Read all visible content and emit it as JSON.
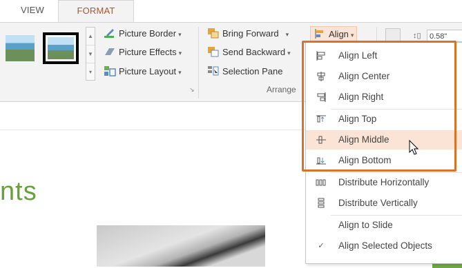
{
  "tabs": {
    "view": "VIEW",
    "format": "FORMAT"
  },
  "ribbon": {
    "picture_styles": {
      "picture_border": "Picture Border",
      "picture_effects": "Picture Effects",
      "picture_layout": "Picture Layout"
    },
    "arrange": {
      "bring_forward": "Bring Forward",
      "send_backward": "Send Backward",
      "selection_pane": "Selection Pane",
      "align": "Align",
      "group_label": "Arrange"
    },
    "size": {
      "height_value": "0.58\""
    }
  },
  "slide": {
    "title_fragment": "nts"
  },
  "align_menu": {
    "items": [
      {
        "label": "Align Left",
        "icon": "align-left-icon"
      },
      {
        "label": "Align Center",
        "icon": "align-center-icon"
      },
      {
        "label": "Align Right",
        "icon": "align-right-icon"
      },
      {
        "label": "Align Top",
        "icon": "align-top-icon"
      },
      {
        "label": "Align Middle",
        "icon": "align-middle-icon"
      },
      {
        "label": "Align Bottom",
        "icon": "align-bottom-icon"
      },
      {
        "label": "Distribute Horizontally",
        "icon": "distribute-horizontally-icon"
      },
      {
        "label": "Distribute Vertically",
        "icon": "distribute-vertically-icon"
      },
      {
        "label": "Align to Slide",
        "icon": ""
      },
      {
        "label": "Align Selected Objects",
        "icon": "checkmark-icon"
      }
    ]
  },
  "colors": {
    "accent_tab": "#b0522a",
    "highlight": "#fbe3d6",
    "callout_border": "#d9722b",
    "title_green": "#67a13a"
  }
}
